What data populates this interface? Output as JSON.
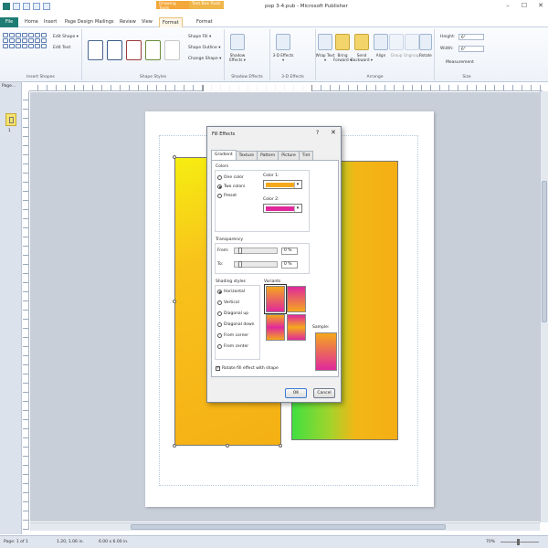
{
  "window": {
    "title": "pop 3-4.pub - Microsoft Publisher",
    "context_drawing": "Drawing Tools",
    "context_textbox": "Text Box Tools",
    "controls": [
      "–",
      "☐",
      "✕"
    ]
  },
  "tabs": {
    "file": "File",
    "home": "Home",
    "insert": "Insert",
    "page_design": "Page Design",
    "mailings": "Mailings",
    "review": "Review",
    "view": "View",
    "format1": "Format",
    "format2": "Format"
  },
  "ribbon": {
    "insert_shapes": {
      "label": "Insert Shapes",
      "edit_shape": "Edit Shape ▾",
      "edit_text": "Edit Text"
    },
    "shape_styles": {
      "label": "Shape Styles",
      "shape_fill": "Shape Fill ▾",
      "shape_outline": "Shape Outline ▾",
      "change_shape": "Change Shape ▾"
    },
    "shadow_effects": {
      "label": "Shadow Effects",
      "button": "Shadow Effects ▾"
    },
    "effects_3d": {
      "label": "3-D Effects",
      "button": "3-D Effects ▾"
    },
    "arrange": {
      "label": "Arrange",
      "wrap_text": "Wrap Text ▾",
      "bring_forward": "Bring Forward ▾",
      "send_backward": "Send Backward ▾",
      "align": "Align",
      "group": "Group",
      "ungroup": "Ungroup",
      "rotate": "Rotate"
    },
    "size": {
      "label": "Size",
      "height_label": "Height:",
      "height_value": "6\"",
      "width_label": "Width:",
      "width_value": "6\"",
      "measurement": "Measurement"
    }
  },
  "pages_pane": {
    "header": "Page...",
    "page_number": "1"
  },
  "dialog": {
    "title": "Fill Effects",
    "help": "?",
    "close": "✕",
    "tabs": [
      "Gradient",
      "Texture",
      "Pattern",
      "Picture",
      "Tint"
    ],
    "colors": {
      "label": "Colors",
      "options": [
        "One color",
        "Two colors",
        "Preset"
      ],
      "color1_label": "Color 1:",
      "color1": "#f5a81c",
      "color2_label": "Color 2:",
      "color2": "#e0289c"
    },
    "transparency": {
      "label": "Transparency",
      "from_label": "From:",
      "from_value": "0 %",
      "to_label": "To:",
      "to_value": "0 %"
    },
    "shading": {
      "label": "Shading styles",
      "options": [
        "Horizontal",
        "Vertical",
        "Diagonal up",
        "Diagonal down",
        "From corner",
        "From center"
      ]
    },
    "variants_label": "Variants",
    "sample_label": "Sample:",
    "rotate_checkbox": "Rotate fill effect with shape",
    "ok": "OK",
    "cancel": "Cancel"
  },
  "statusbar": {
    "page": "Page: 1 of 1",
    "position": "1.20, 1.06 in.",
    "size": "6.00 x 6.00 in.",
    "zoom": "70%"
  }
}
